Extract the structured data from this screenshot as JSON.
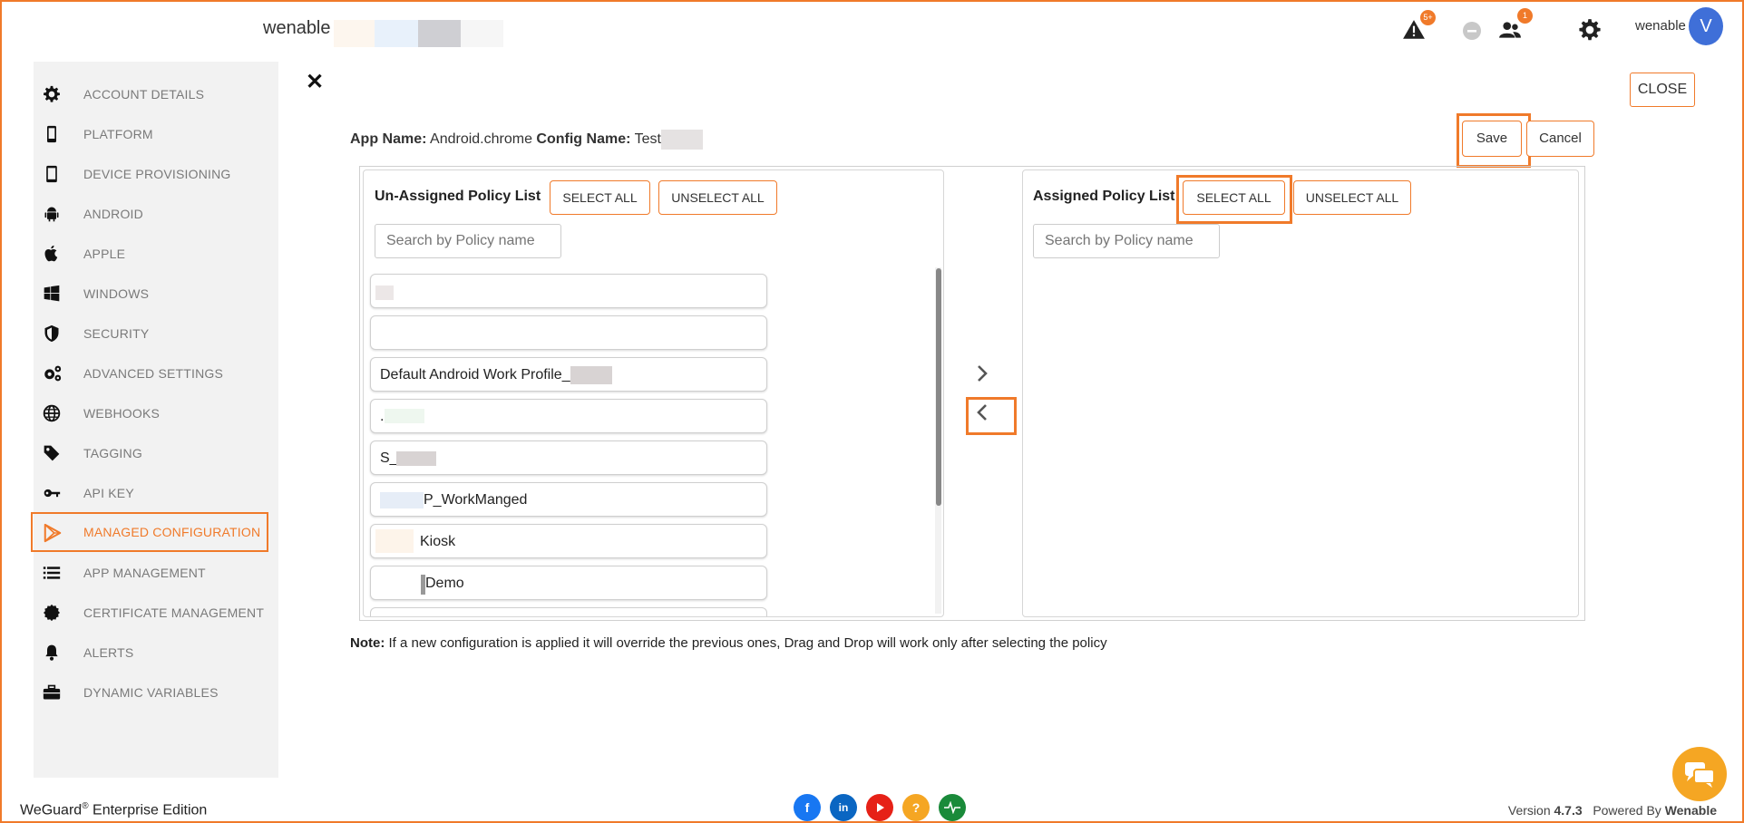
{
  "header": {
    "brand": "wenable",
    "alert_badge": "5+",
    "users_badge": "1",
    "user_name": "wenable",
    "avatar_initial": "V"
  },
  "sidebar": {
    "items": [
      {
        "label": "ACCOUNT DETAILS",
        "icon": "gear-icon"
      },
      {
        "label": "PLATFORM",
        "icon": "phone-icon"
      },
      {
        "label": "DEVICE PROVISIONING",
        "icon": "mobile-icon"
      },
      {
        "label": "ANDROID",
        "icon": "android-icon"
      },
      {
        "label": "APPLE",
        "icon": "apple-icon"
      },
      {
        "label": "WINDOWS",
        "icon": "windows-icon"
      },
      {
        "label": "SECURITY",
        "icon": "shield-icon"
      },
      {
        "label": "ADVANCED SETTINGS",
        "icon": "gears-icon"
      },
      {
        "label": "WEBHOOKS",
        "icon": "globe-icon"
      },
      {
        "label": "TAGGING",
        "icon": "tag-icon"
      },
      {
        "label": "API KEY",
        "icon": "key-icon"
      },
      {
        "label": "MANAGED CONFIGURATION",
        "icon": "play-store-icon",
        "active": true
      },
      {
        "label": "APP MANAGEMENT",
        "icon": "list-icon"
      },
      {
        "label": "CERTIFICATE MANAGEMENT",
        "icon": "certificate-icon"
      },
      {
        "label": "ALERTS",
        "icon": "bell-icon"
      },
      {
        "label": "DYNAMIC VARIABLES",
        "icon": "briefcase-icon"
      }
    ]
  },
  "main": {
    "close_label": "CLOSE",
    "app_name_label": "App Name:",
    "app_name_value": "Android.chrome",
    "config_name_label": "Config Name:",
    "config_name_value": "Test",
    "save_label": "Save",
    "cancel_label": "Cancel",
    "unassigned": {
      "title": "Un-Assigned Policy List",
      "select_all": "SELECT ALL",
      "unselect_all": "UNSELECT ALL",
      "search_placeholder": "Search by Policy name",
      "items": [
        "",
        "",
        "Default Android Work Profile_",
        ".",
        "S_",
        "P_WorkManged",
        "Kiosk",
        "Demo"
      ]
    },
    "assigned": {
      "title": "Assigned Policy List",
      "select_all": "SELECT ALL",
      "unselect_all": "UNSELECT ALL",
      "search_placeholder": "Search by Policy name"
    },
    "note_label": "Note:",
    "note_text": "If a new configuration is applied it will override the previous ones, Drag and Drop will work only after selecting the policy"
  },
  "footer": {
    "product": "WeGuard",
    "reg": "®",
    "edition": "Enterprise Edition",
    "version_label": "Version",
    "version": "4.7.3",
    "powered_label": "Powered By",
    "powered_by": "Wenable"
  },
  "colors": {
    "accent": "#f07a2a",
    "avatar": "#3f6fd8",
    "facebook": "#1877f2",
    "linkedin": "#0a66c2",
    "youtube": "#e62117",
    "help": "#f5a623",
    "status": "#1a8a3a"
  }
}
